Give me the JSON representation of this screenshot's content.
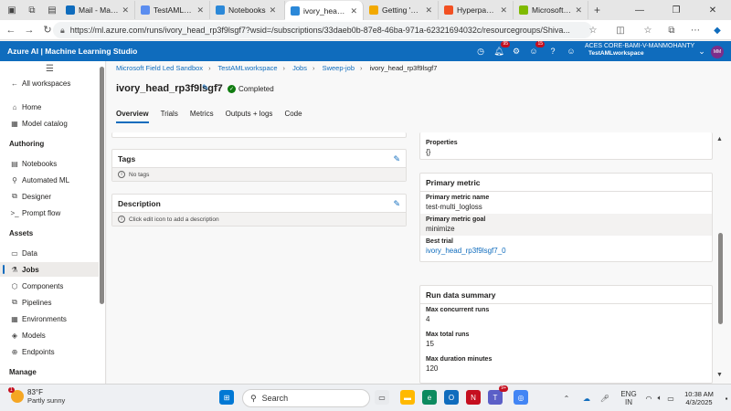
{
  "browser": {
    "tabs": [
      {
        "label": "Mail - Manas",
        "color": "#0f6cbd"
      },
      {
        "label": "TestAMLwork",
        "color": "#5b8def"
      },
      {
        "label": "Notebooks",
        "color": "#2b88d8"
      },
      {
        "label": "ivory_head_rp",
        "color": "#2b88d8",
        "active": true
      },
      {
        "label": "Getting 'som",
        "color": "#f2a900"
      },
      {
        "label": "Hyperparame",
        "color": "#f25022"
      },
      {
        "label": "Microsoft Sa",
        "color": "#7fba00"
      }
    ],
    "url": "https://ml.azure.com/runs/ivory_head_rp3f9lsgf7?wsid=/subscriptions/33daeb0b-87e8-46ba-971a-62321694032c/resourcegroups/Shiva..."
  },
  "header": {
    "brand": "Azure AI | Machine Learning Studio",
    "notif_count": "95",
    "alert_count": "15",
    "account_name": "ACES CORE-BAMI-V-MANMOHANTY",
    "workspace": "TestAMLworkspace",
    "avatar_initials": "MM"
  },
  "sidebar": {
    "all_workspaces": "All workspaces",
    "home": "Home",
    "model_catalog": "Model catalog",
    "authoring_head": "Authoring",
    "notebooks": "Notebooks",
    "automated_ml": "Automated ML",
    "designer": "Designer",
    "prompt_flow": "Prompt flow",
    "assets_head": "Assets",
    "data": "Data",
    "jobs": "Jobs",
    "components": "Components",
    "pipelines": "Pipelines",
    "environments": "Environments",
    "models": "Models",
    "endpoints": "Endpoints",
    "manage_head": "Manage"
  },
  "breadcrumb": [
    "Microsoft Field Led Sandbox",
    "TestAMLworkspace",
    "Jobs",
    "Sweep-job",
    "ivory_head_rp3f9lsgf7"
  ],
  "page": {
    "title": "ivory_head_rp3f9lsgf7",
    "status": "Completed",
    "tabs": [
      "Overview",
      "Trials",
      "Metrics",
      "Outputs + logs",
      "Code"
    ]
  },
  "tags_card": {
    "title": "Tags",
    "note": "No tags"
  },
  "description_card": {
    "title": "Description",
    "note": "Click edit icon to add a description"
  },
  "properties_card": {
    "title": "Properties",
    "value": "{}"
  },
  "primary_metric": {
    "title": "Primary metric",
    "name_label": "Primary metric name",
    "name_value": "test-multi_logloss",
    "goal_label": "Primary metric goal",
    "goal_value": "minimize",
    "best_label": "Best trial",
    "best_value": "ivory_head_rp3f9lsgf7_0"
  },
  "run_summary": {
    "title": "Run data summary",
    "concurrent_label": "Max concurrent runs",
    "concurrent_value": "4",
    "total_label": "Max total runs",
    "total_value": "15",
    "duration_label": "Max duration minutes",
    "duration_value": "120"
  },
  "taskbar": {
    "temp": "83°F",
    "condition": "Partly sunny",
    "weather_badge": "1",
    "search": "Search",
    "teams_badge": "9+",
    "lang1": "ENG",
    "lang2": "IN",
    "time": "10:38 AM",
    "date": "4/3/2025"
  }
}
